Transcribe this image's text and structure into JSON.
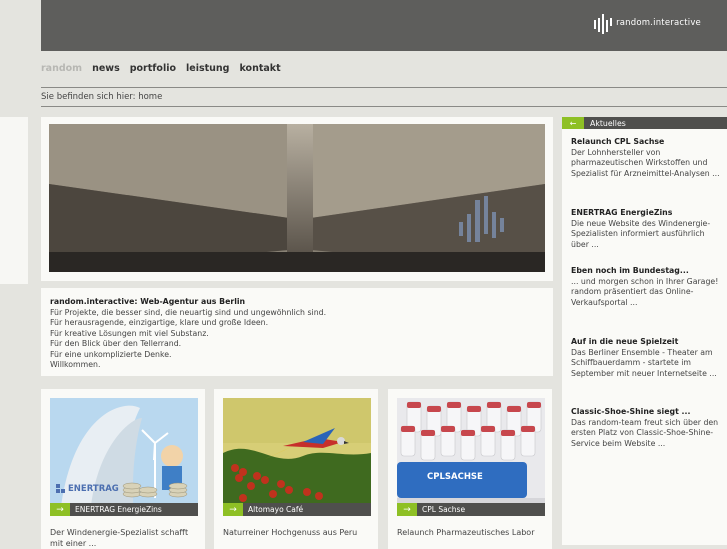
{
  "brand": {
    "name": "random.interactive"
  },
  "nav": {
    "items": [
      {
        "label": "random",
        "active": true
      },
      {
        "label": "news",
        "active": false
      },
      {
        "label": "portfolio",
        "active": false
      },
      {
        "label": "leistung",
        "active": false
      },
      {
        "label": "kontakt",
        "active": false
      }
    ]
  },
  "breadcrumb": {
    "prefix": "Sie befinden sich hier:",
    "current": "home"
  },
  "intro": {
    "title": "random.interactive: Web-Agentur aus Berlin",
    "lines": [
      "Für Projekte, die besser sind, die neuartig sind und ungewöhnlich sind.",
      "Für herausragende, einzigartige, klare und große Ideen.",
      "Für kreative Lösungen mit viel Substanz.",
      "Für den Blick über den Tellerrand.",
      "Für eine unkomplizierte Denke.",
      "Willkommen."
    ]
  },
  "cards": [
    {
      "caption": "ENERTRAG EnergieZins",
      "logo_text": "ENERTRAG",
      "desc": "Der Windenergie-Spezialist schafft mit einer ..."
    },
    {
      "caption": "Altomayo Café",
      "desc": "Naturreiner Hochgenuss aus Peru"
    },
    {
      "caption": "CPL Sachse",
      "logo_text": "CPLSACHSE",
      "desc": "Relaunch Pharmazeutisches Labor"
    }
  ],
  "sidebar": {
    "title": "Aktuelles",
    "news": [
      {
        "title": "Relaunch CPL Sachse",
        "text": "Der Lohnhersteller von pharmazeutischen Wirkstoffen und Spezialist für Arzneimittel-Analysen ..."
      },
      {
        "title": "ENERTRAG EnergieZins",
        "text": "Die neue Website des Windenergie-Spezialisten informiert ausführlich über ..."
      },
      {
        "title": "Eben noch im Bundestag...",
        "text": "... und morgen schon in Ihrer Garage! random präsentiert das Online-Verkaufsportal ..."
      },
      {
        "title": "Auf in die neue Spielzeit",
        "text": "Das Berliner Ensemble - Theater am Schiffbauerdamm - startete im September mit neuer Internetseite ..."
      },
      {
        "title": "Classic-Shoe-Shine siegt ...",
        "text": "Das random-team freut sich über den ersten Platz von Classic-Shoe-Shine-Service beim Website ..."
      }
    ]
  },
  "colors": {
    "accent": "#8ec025",
    "header": "#5e5e5c",
    "caption_bar": "#4f4f4d"
  },
  "icons": {
    "arrow": "arrow-right-icon",
    "back": "arrow-left-icon"
  }
}
